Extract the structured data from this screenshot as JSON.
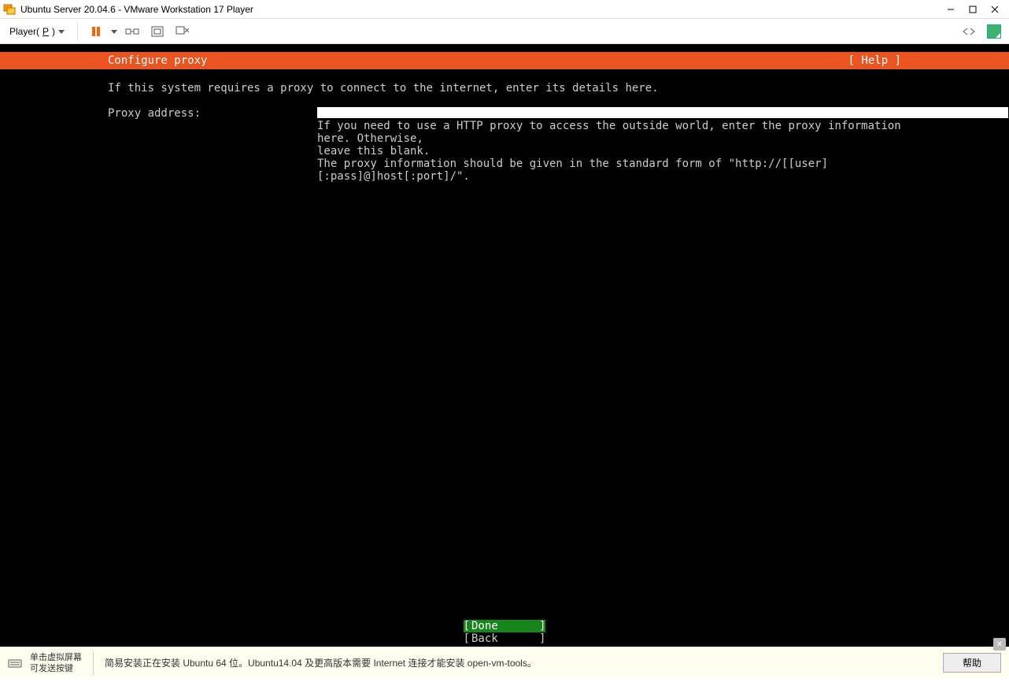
{
  "window": {
    "title": " Ubuntu Server 20.04.6 - VMware Workstation 17 Player"
  },
  "toolbar": {
    "player_label": "Player(",
    "player_key": "P",
    "player_close": ")"
  },
  "installer": {
    "header_title": "Configure proxy",
    "header_help": "[ Help ]",
    "intro": "If this system requires a proxy to connect to the internet, enter its details here.",
    "proxy_label": "Proxy address:",
    "proxy_value": "",
    "hint1": "If you need to use a HTTP proxy to access the outside world, enter the proxy information here. Otherwise,\nleave this blank.",
    "hint2": "The proxy information should be given in the standard form of \"http://[[user][:pass]@]host[:port]/\".",
    "done_label": "Done",
    "back_label": "Back"
  },
  "status": {
    "kb_line1": "单击虚拟屏幕",
    "kb_line2": "可发送按键",
    "install_msg": "简易安装正在安装 Ubuntu 64 位。Ubuntu14.04 及更高版本需要 Internet 连接才能安装 open-vm-tools。",
    "help_btn": "帮助"
  }
}
